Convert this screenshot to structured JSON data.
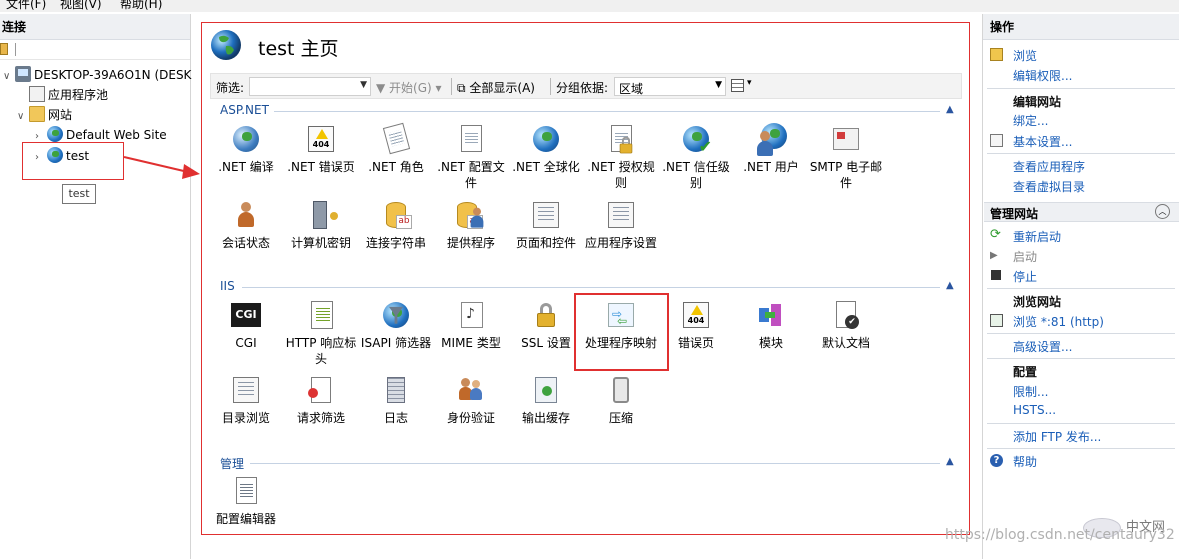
{
  "menubar": {
    "file": "文件(F)",
    "view": "视图(V)",
    "help": "帮助(H)"
  },
  "left": {
    "header": "连接",
    "tree": {
      "server": "DESKTOP-39A6O1N (DESK",
      "app_pools": "应用程序池",
      "sites": "网站",
      "default_site": "Default Web Site",
      "test_site": "test"
    },
    "tooltip": "test"
  },
  "center": {
    "title": "test 主页",
    "filter": {
      "label": "筛选:",
      "value": "",
      "start": "开始(G)",
      "show_all": "全部显示(A)",
      "group_by_label": "分组依据:",
      "group_by_value": "区域"
    },
    "sections": [
      {
        "title": "ASP.NET",
        "items": [
          {
            "label": ".NET 编译",
            "icon": "gear-icon"
          },
          {
            "label": ".NET 错误页",
            "icon": "error-page-icon"
          },
          {
            "label": ".NET 角色",
            "icon": "roles-icon"
          },
          {
            "label": ".NET 配置文件",
            "icon": "profile-icon"
          },
          {
            "label": ".NET 全球化",
            "icon": "globe-icon"
          },
          {
            "label": ".NET 授权规则",
            "icon": "lock-icon"
          },
          {
            "label": ".NET 信任级别",
            "icon": "trust-icon"
          },
          {
            "label": ".NET 用户",
            "icon": "users-icon"
          },
          {
            "label": "SMTP 电子邮件",
            "icon": "mail-icon"
          },
          {
            "label": "会话状态",
            "icon": "session-icon"
          },
          {
            "label": "计算机密钥",
            "icon": "machine-key-icon"
          },
          {
            "label": "连接字符串",
            "icon": "connection-string-icon"
          },
          {
            "label": "提供程序",
            "icon": "provider-icon"
          },
          {
            "label": "页面和控件",
            "icon": "pages-controls-icon"
          },
          {
            "label": "应用程序设置",
            "icon": "app-settings-icon"
          }
        ]
      },
      {
        "title": "IIS",
        "items": [
          {
            "label": "CGI",
            "icon": "cgi-icon",
            "icon_text": "CGI"
          },
          {
            "label": "HTTP 响应标头",
            "icon": "http-headers-icon"
          },
          {
            "label": "ISAPI 筛选器",
            "icon": "isapi-filter-icon"
          },
          {
            "label": "MIME 类型",
            "icon": "mime-icon"
          },
          {
            "label": "SSL 设置",
            "icon": "ssl-lock-icon"
          },
          {
            "label": "处理程序映射",
            "icon": "handler-mappings-icon"
          },
          {
            "label": "错误页",
            "icon": "error-page-icon",
            "icon_text": "404"
          },
          {
            "label": "模块",
            "icon": "modules-icon"
          },
          {
            "label": "默认文档",
            "icon": "default-document-icon"
          },
          {
            "label": "目录浏览",
            "icon": "directory-browsing-icon"
          },
          {
            "label": "请求筛选",
            "icon": "request-filtering-icon"
          },
          {
            "label": "日志",
            "icon": "logging-icon"
          },
          {
            "label": "身份验证",
            "icon": "authentication-icon"
          },
          {
            "label": "输出缓存",
            "icon": "output-cache-icon"
          },
          {
            "label": "压缩",
            "icon": "compression-icon"
          }
        ]
      },
      {
        "title": "管理",
        "items": [
          {
            "label": "配置编辑器",
            "icon": "config-editor-icon"
          }
        ]
      }
    ],
    "error_icon_text": "404"
  },
  "right": {
    "header": "操作",
    "browse": "浏览",
    "edit_permissions": "编辑权限...",
    "edit_site": "编辑网站",
    "bindings": "绑定...",
    "basic_settings": "基本设置...",
    "view_applications": "查看应用程序",
    "view_virtual_dirs": "查看虚拟目录",
    "manage_site": "管理网站",
    "restart": "重新启动",
    "start": "启动",
    "stop": "停止",
    "browse_site": "浏览网站",
    "browse_port": "浏览 *:81 (http)",
    "advanced_settings": "高级设置...",
    "config": "配置",
    "limits": "限制...",
    "hsts": "HSTS...",
    "add_ftp": "添加 FTP 发布...",
    "help": "帮助"
  },
  "watermark": {
    "url": "https://blog.csdn.net/centaury32",
    "brand": "中文网"
  },
  "colors": {
    "accent": "#1a5eb8",
    "highlight_red": "#e03030"
  }
}
